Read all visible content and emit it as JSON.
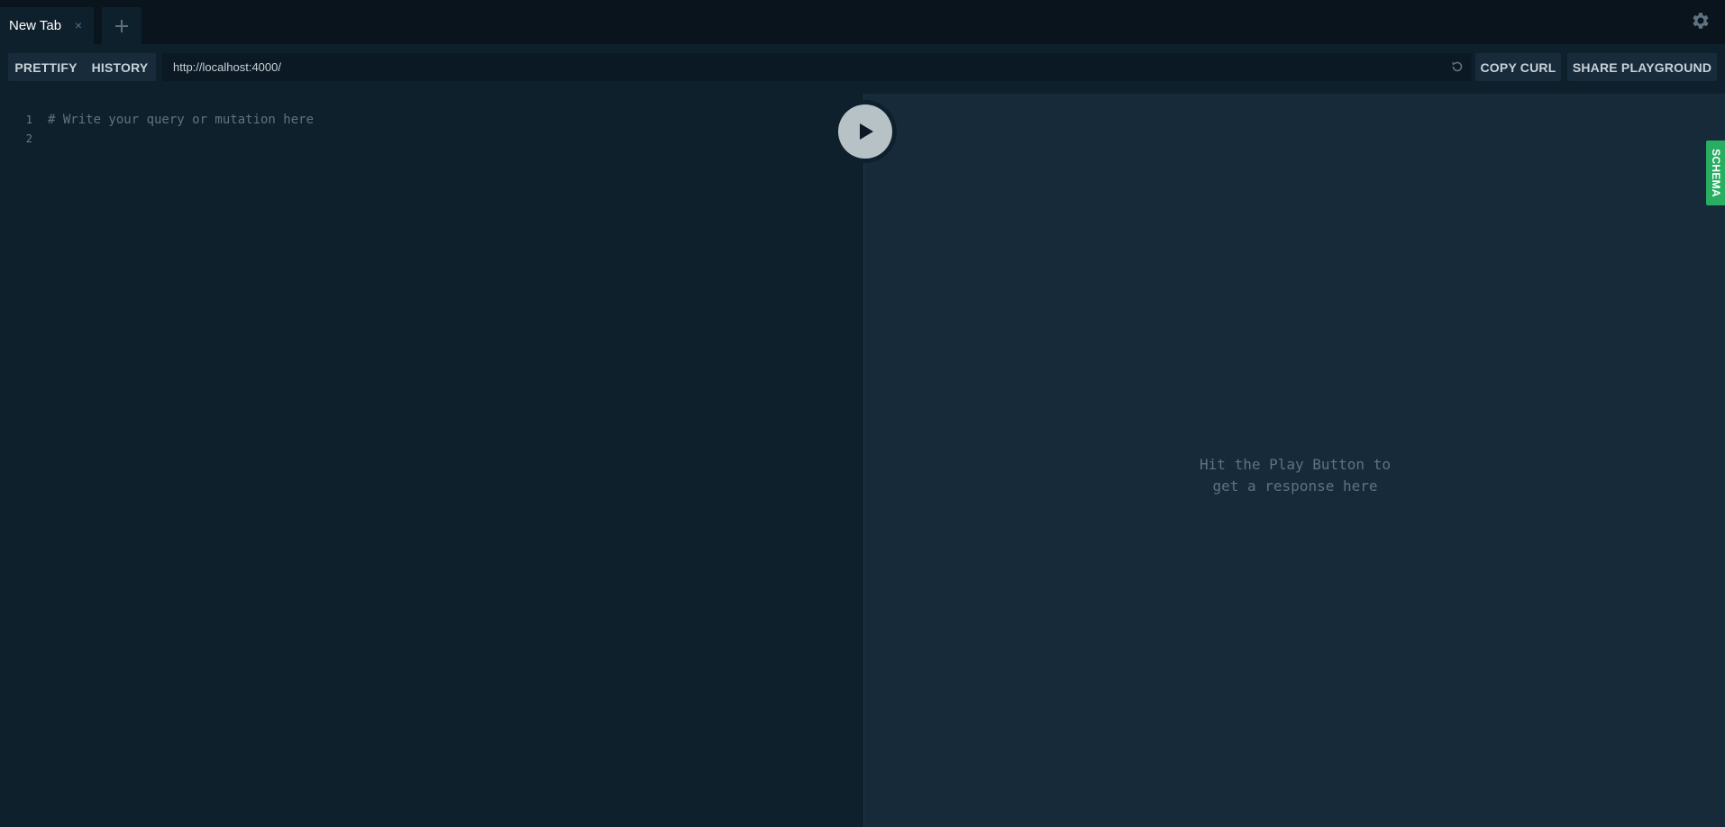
{
  "tabs": [
    {
      "label": "New Tab",
      "close_symbol": "×",
      "icon": "close-icon"
    }
  ],
  "add_tab_icon": "plus-icon",
  "settings_icon": "gear-icon",
  "toolbar": {
    "prettify_label": "PRETTIFY",
    "history_label": "HISTORY",
    "endpoint_url": "http://localhost:4000/",
    "reload_icon": "reload-icon",
    "copy_curl_label": "COPY CURL",
    "share_label": "SHARE PLAYGROUND"
  },
  "editor": {
    "lines": [
      {
        "number": "1",
        "text": "# Write your query or mutation here"
      },
      {
        "number": "2",
        "text": ""
      }
    ]
  },
  "play_icon": "play-icon",
  "result": {
    "line1": "Hit the Play Button to",
    "line2": "get a response here"
  },
  "schema_label": "SCHEMA",
  "colors": {
    "background": "#0f202d",
    "tabbar": "#09141c",
    "result_bg": "#172a3a",
    "schema_green": "#27ae60",
    "play_button": "#b7c2c7"
  }
}
